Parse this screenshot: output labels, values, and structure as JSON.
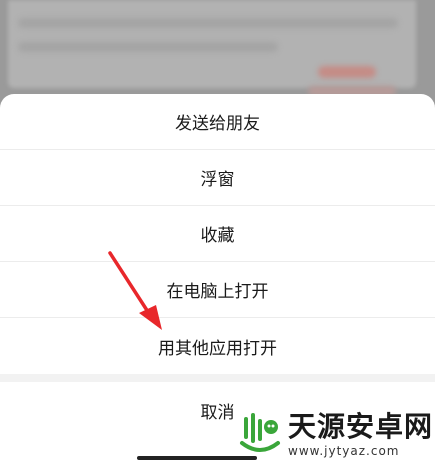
{
  "sheet": {
    "items": [
      {
        "label": "发送给朋友"
      },
      {
        "label": "浮窗"
      },
      {
        "label": "收藏"
      },
      {
        "label": "在电脑上打开"
      },
      {
        "label": "用其他应用打开"
      }
    ],
    "cancel_label": "取消"
  },
  "watermark": {
    "name": "天源安卓网",
    "url": "www.jytyaz.com"
  },
  "colors": {
    "arrow": "#e8272b",
    "logo_green": "#3aa63a"
  },
  "icons": {
    "arrow": "red-annotation-arrow",
    "logo": "android-logo-icon"
  }
}
